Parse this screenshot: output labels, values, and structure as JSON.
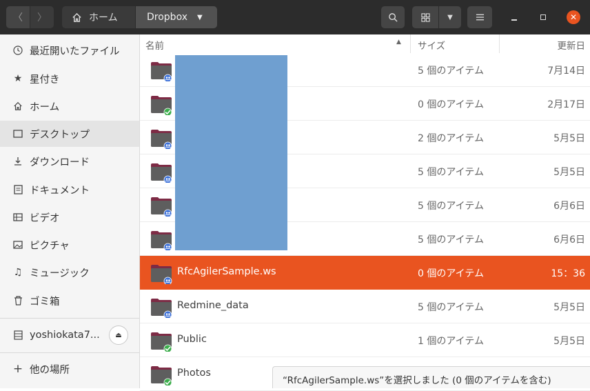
{
  "header": {
    "home_label": "ホーム",
    "current_folder": "Dropbox"
  },
  "sidebar": {
    "items": [
      {
        "label": "最近開いたファイル",
        "icon": "clock-icon"
      },
      {
        "label": "星付き",
        "icon": "star-icon"
      },
      {
        "label": "ホーム",
        "icon": "home-icon"
      },
      {
        "label": "デスクトップ",
        "icon": "desktop-icon"
      },
      {
        "label": "ダウンロード",
        "icon": "download-icon"
      },
      {
        "label": "ドキュメント",
        "icon": "document-icon"
      },
      {
        "label": "ビデオ",
        "icon": "video-icon"
      },
      {
        "label": "ピクチャ",
        "icon": "picture-icon"
      },
      {
        "label": "ミュージック",
        "icon": "music-icon"
      },
      {
        "label": "ゴミ箱",
        "icon": "trash-icon"
      }
    ],
    "drive_label": "yoshiokata7...",
    "other_locations": "他の場所"
  },
  "columns": {
    "name": "名前",
    "size": "サイズ",
    "modified": "更新日"
  },
  "files": [
    {
      "name": "",
      "size": "5 個のアイテム",
      "modified": "7月14日",
      "emblem": "shared"
    },
    {
      "name": "",
      "size": "0 個のアイテム",
      "modified": "2月17日",
      "emblem": "synced"
    },
    {
      "name": "",
      "size": "2 個のアイテム",
      "modified": "5月5日",
      "emblem": "shared"
    },
    {
      "name": "",
      "size": "5 個のアイテム",
      "modified": "5月5日",
      "emblem": "shared"
    },
    {
      "name": "",
      "size": "5 個のアイテム",
      "modified": "6月6日",
      "emblem": "shared"
    },
    {
      "name": "",
      "size": "5 個のアイテム",
      "modified": "6月6日",
      "emblem": "shared"
    },
    {
      "name": "RfcAgilerSample.ws",
      "size": "0 個のアイテム",
      "modified": "15：36",
      "emblem": "shared",
      "selected": true
    },
    {
      "name": "Redmine_data",
      "size": "5 個のアイテム",
      "modified": "5月5日",
      "emblem": "shared"
    },
    {
      "name": "Public",
      "size": "1 個のアイテム",
      "modified": "5月5日",
      "emblem": "synced"
    },
    {
      "name": "Photos",
      "size": "",
      "modified": "",
      "emblem": "synced"
    }
  ],
  "status": "“RfcAgilerSample.ws”を選択しました (0 個のアイテムを含む)",
  "colors": {
    "accent": "#e95420",
    "folder_top": "#7d2b45",
    "folder_body": "#5e5e5e",
    "emblem_shared": "#3a6fd8",
    "emblem_synced": "#3cae4c",
    "redaction": "#6f9fd0"
  }
}
